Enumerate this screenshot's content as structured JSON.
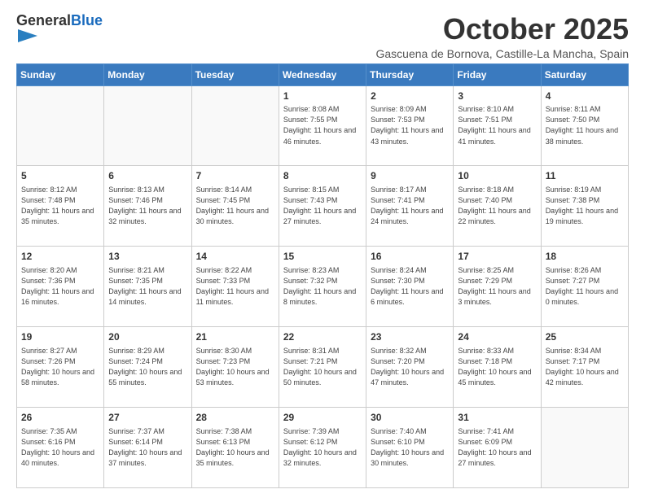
{
  "header": {
    "logo_general": "General",
    "logo_blue": "Blue",
    "month": "October 2025",
    "location": "Gascuena de Bornova, Castille-La Mancha, Spain"
  },
  "days_of_week": [
    "Sunday",
    "Monday",
    "Tuesday",
    "Wednesday",
    "Thursday",
    "Friday",
    "Saturday"
  ],
  "weeks": [
    [
      {
        "day": "",
        "info": ""
      },
      {
        "day": "",
        "info": ""
      },
      {
        "day": "",
        "info": ""
      },
      {
        "day": "1",
        "info": "Sunrise: 8:08 AM\nSunset: 7:55 PM\nDaylight: 11 hours and 46 minutes."
      },
      {
        "day": "2",
        "info": "Sunrise: 8:09 AM\nSunset: 7:53 PM\nDaylight: 11 hours and 43 minutes."
      },
      {
        "day": "3",
        "info": "Sunrise: 8:10 AM\nSunset: 7:51 PM\nDaylight: 11 hours and 41 minutes."
      },
      {
        "day": "4",
        "info": "Sunrise: 8:11 AM\nSunset: 7:50 PM\nDaylight: 11 hours and 38 minutes."
      }
    ],
    [
      {
        "day": "5",
        "info": "Sunrise: 8:12 AM\nSunset: 7:48 PM\nDaylight: 11 hours and 35 minutes."
      },
      {
        "day": "6",
        "info": "Sunrise: 8:13 AM\nSunset: 7:46 PM\nDaylight: 11 hours and 32 minutes."
      },
      {
        "day": "7",
        "info": "Sunrise: 8:14 AM\nSunset: 7:45 PM\nDaylight: 11 hours and 30 minutes."
      },
      {
        "day": "8",
        "info": "Sunrise: 8:15 AM\nSunset: 7:43 PM\nDaylight: 11 hours and 27 minutes."
      },
      {
        "day": "9",
        "info": "Sunrise: 8:17 AM\nSunset: 7:41 PM\nDaylight: 11 hours and 24 minutes."
      },
      {
        "day": "10",
        "info": "Sunrise: 8:18 AM\nSunset: 7:40 PM\nDaylight: 11 hours and 22 minutes."
      },
      {
        "day": "11",
        "info": "Sunrise: 8:19 AM\nSunset: 7:38 PM\nDaylight: 11 hours and 19 minutes."
      }
    ],
    [
      {
        "day": "12",
        "info": "Sunrise: 8:20 AM\nSunset: 7:36 PM\nDaylight: 11 hours and 16 minutes."
      },
      {
        "day": "13",
        "info": "Sunrise: 8:21 AM\nSunset: 7:35 PM\nDaylight: 11 hours and 14 minutes."
      },
      {
        "day": "14",
        "info": "Sunrise: 8:22 AM\nSunset: 7:33 PM\nDaylight: 11 hours and 11 minutes."
      },
      {
        "day": "15",
        "info": "Sunrise: 8:23 AM\nSunset: 7:32 PM\nDaylight: 11 hours and 8 minutes."
      },
      {
        "day": "16",
        "info": "Sunrise: 8:24 AM\nSunset: 7:30 PM\nDaylight: 11 hours and 6 minutes."
      },
      {
        "day": "17",
        "info": "Sunrise: 8:25 AM\nSunset: 7:29 PM\nDaylight: 11 hours and 3 minutes."
      },
      {
        "day": "18",
        "info": "Sunrise: 8:26 AM\nSunset: 7:27 PM\nDaylight: 11 hours and 0 minutes."
      }
    ],
    [
      {
        "day": "19",
        "info": "Sunrise: 8:27 AM\nSunset: 7:26 PM\nDaylight: 10 hours and 58 minutes."
      },
      {
        "day": "20",
        "info": "Sunrise: 8:29 AM\nSunset: 7:24 PM\nDaylight: 10 hours and 55 minutes."
      },
      {
        "day": "21",
        "info": "Sunrise: 8:30 AM\nSunset: 7:23 PM\nDaylight: 10 hours and 53 minutes."
      },
      {
        "day": "22",
        "info": "Sunrise: 8:31 AM\nSunset: 7:21 PM\nDaylight: 10 hours and 50 minutes."
      },
      {
        "day": "23",
        "info": "Sunrise: 8:32 AM\nSunset: 7:20 PM\nDaylight: 10 hours and 47 minutes."
      },
      {
        "day": "24",
        "info": "Sunrise: 8:33 AM\nSunset: 7:18 PM\nDaylight: 10 hours and 45 minutes."
      },
      {
        "day": "25",
        "info": "Sunrise: 8:34 AM\nSunset: 7:17 PM\nDaylight: 10 hours and 42 minutes."
      }
    ],
    [
      {
        "day": "26",
        "info": "Sunrise: 7:35 AM\nSunset: 6:16 PM\nDaylight: 10 hours and 40 minutes."
      },
      {
        "day": "27",
        "info": "Sunrise: 7:37 AM\nSunset: 6:14 PM\nDaylight: 10 hours and 37 minutes."
      },
      {
        "day": "28",
        "info": "Sunrise: 7:38 AM\nSunset: 6:13 PM\nDaylight: 10 hours and 35 minutes."
      },
      {
        "day": "29",
        "info": "Sunrise: 7:39 AM\nSunset: 6:12 PM\nDaylight: 10 hours and 32 minutes."
      },
      {
        "day": "30",
        "info": "Sunrise: 7:40 AM\nSunset: 6:10 PM\nDaylight: 10 hours and 30 minutes."
      },
      {
        "day": "31",
        "info": "Sunrise: 7:41 AM\nSunset: 6:09 PM\nDaylight: 10 hours and 27 minutes."
      },
      {
        "day": "",
        "info": ""
      }
    ]
  ]
}
